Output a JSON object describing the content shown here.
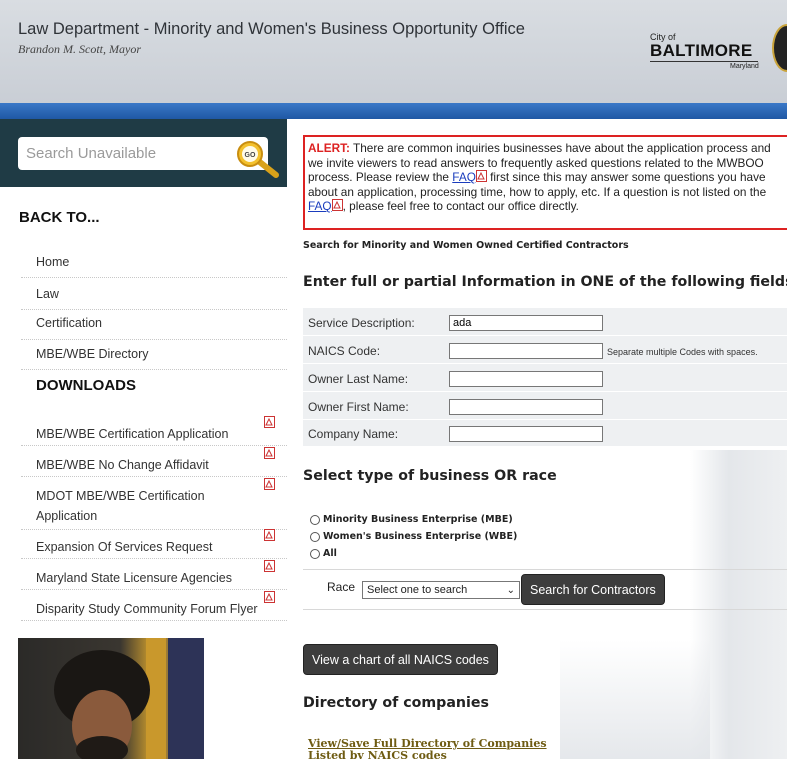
{
  "header": {
    "title": "Law Department - Minority and Women's Business Opportunity Office",
    "subtitle": "Brandon M. Scott, Mayor",
    "logo": {
      "city_of": "City of",
      "city": "BALTIMORE",
      "state": "Maryland"
    }
  },
  "sidebar": {
    "search_placeholder": "Search Unavailable",
    "go_label": "GO",
    "back_heading": "BACK TO...",
    "back_items": [
      {
        "label": "Home"
      },
      {
        "label": "Law"
      },
      {
        "label": "Certification"
      },
      {
        "label": "MBE/WBE Directory"
      }
    ],
    "downloads_heading": "DOWNLOADS",
    "download_items": [
      {
        "label": "MBE/WBE Certification Application"
      },
      {
        "label": "MBE/WBE No Change Affidavit"
      },
      {
        "label": "MDOT MBE/WBE Certification",
        "label2": "Application"
      },
      {
        "label": "Expansion Of Services Request"
      },
      {
        "label": "Maryland State Licensure Agencies"
      },
      {
        "label": "Disparity Study Community Forum Flyer"
      }
    ]
  },
  "alert": {
    "label": "ALERT:",
    "text1": " There are common inquiries businesses have about the application process and we invite viewers to read answers to frequently asked questions related to the MWBOO process. Please review the ",
    "faq1": "FAQ",
    "text2": " first since this may answer some questions you have about an application, processing time, how to apply, etc. If a question is not listed on the ",
    "faq2": "FAQ",
    "text3": ", please feel free to contact our office directly."
  },
  "main": {
    "search_caption": "Search for Minority and Women Owned Certified Contractors",
    "fields_heading": "Enter full or partial Information in ONE of the following fields:",
    "fields": [
      {
        "label": "Service Description:",
        "value": "ada"
      },
      {
        "label": "NAICS Code:",
        "value": "",
        "hint": "Separate multiple Codes with spaces."
      },
      {
        "label": "Owner Last Name:",
        "value": ""
      },
      {
        "label": "Owner First Name:",
        "value": ""
      },
      {
        "label": "Company Name:",
        "value": ""
      }
    ],
    "type_heading": "Select type of business OR race",
    "radios": [
      {
        "label": "Minority Business Enterprise (MBE)"
      },
      {
        "label": "Women's Business Enterprise (WBE)"
      },
      {
        "label": "All"
      }
    ],
    "race_label": "Race",
    "race_selected": "Select one to search",
    "search_button": "Search for Contractors",
    "naics_chart_button": "View a chart of all NAICS codes",
    "directory_heading": "Directory of companies",
    "directory_link1": "View/Save Full Directory of Companies",
    "directory_link2": "Listed by NAICS codes"
  },
  "colors": {
    "alert_red": "#dd2222",
    "header_blue": "#1f58a4",
    "sidebar_dark": "#1f3b45",
    "link_gold": "#6e5b12"
  }
}
